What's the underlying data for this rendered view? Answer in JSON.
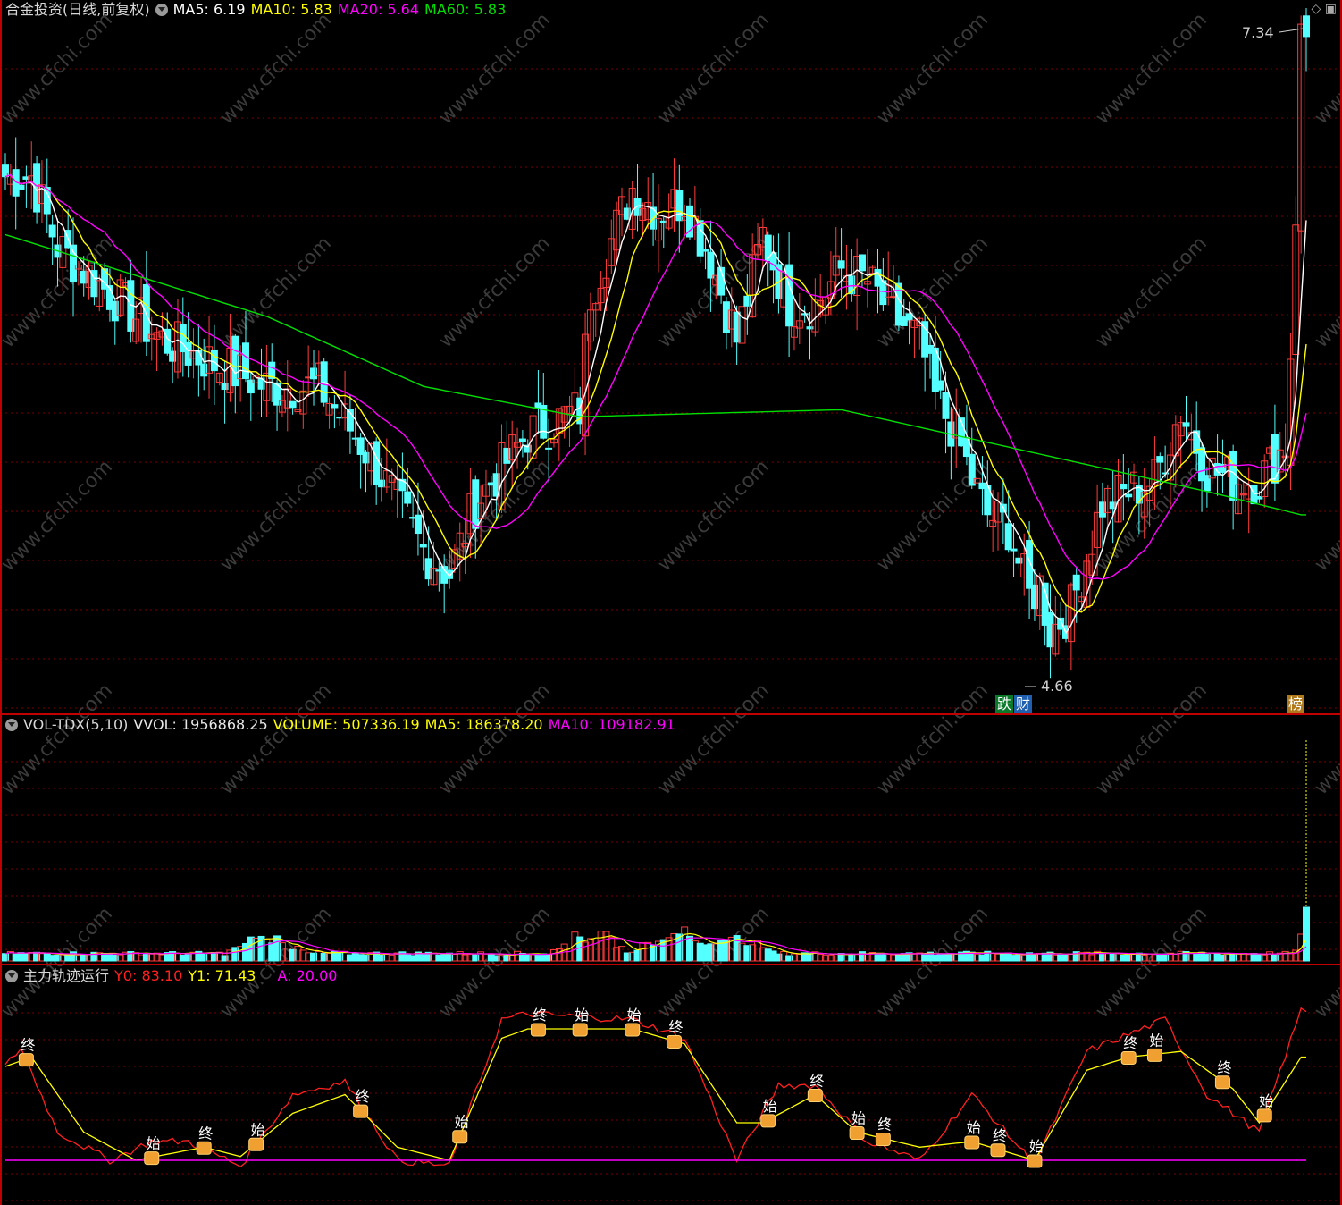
{
  "price_panel": {
    "title": "合金投资(日线,前复权)",
    "ma5": "MA5: 6.19",
    "ma10": "MA10: 5.83",
    "ma20": "MA20: 5.64",
    "ma60": "MA60: 5.83",
    "high_label": "7.34",
    "low_label": "4.66",
    "tags": [
      "跌",
      "财",
      "榜"
    ]
  },
  "volume_panel": {
    "title": "VOL-TDX(5,10)",
    "vvol": "VVOL: 1956868.25",
    "volume": "VOLUME: 507336.19",
    "ma5": "MA5: 186378.20",
    "ma10": "MA10: 109182.91"
  },
  "indicator_panel": {
    "title": "主力轨迹运行",
    "y0": "Y0: 83.10",
    "y1": "Y1: 71.43",
    "a": "A: 20.00",
    "start_label": "始",
    "end_label": "终"
  },
  "colors": {
    "up": "#ff3c3c",
    "down": "#54ffff",
    "ma5": "#ffffff",
    "ma10": "#ffff00",
    "ma20": "#ff00ff",
    "ma60": "#00e000",
    "grid": "#7a0000",
    "frame": "#c00000",
    "watermark": "#3a3a3a"
  },
  "watermark": "www.cfchi.com",
  "chart_data": [
    {
      "type": "candlestick",
      "title": "合金投资(日线,前复权)",
      "series_names": [
        "MA5",
        "MA10",
        "MA20",
        "MA60"
      ],
      "highest": 7.34,
      "lowest": 4.66,
      "close_anchors": [
        [
          0,
          6.7
        ],
        [
          5,
          6.7
        ],
        [
          10,
          6.4
        ],
        [
          20,
          6.2
        ],
        [
          30,
          6.0
        ],
        [
          40,
          5.9
        ],
        [
          50,
          5.8
        ],
        [
          60,
          5.8
        ],
        [
          70,
          5.5
        ],
        [
          80,
          5.1
        ],
        [
          85,
          5.0
        ],
        [
          90,
          5.3
        ],
        [
          100,
          5.6
        ],
        [
          110,
          5.7
        ],
        [
          112,
          6.2
        ],
        [
          120,
          6.65
        ],
        [
          125,
          6.55
        ],
        [
          130,
          6.6
        ],
        [
          135,
          6.35
        ],
        [
          140,
          6.0
        ],
        [
          145,
          6.45
        ],
        [
          150,
          6.15
        ],
        [
          155,
          6.15
        ],
        [
          160,
          6.3
        ],
        [
          165,
          6.25
        ],
        [
          170,
          6.1
        ],
        [
          175,
          6.0
        ],
        [
          178,
          5.75
        ],
        [
          182,
          5.6
        ],
        [
          185,
          5.4
        ],
        [
          188,
          5.25
        ],
        [
          192,
          5.2
        ],
        [
          196,
          4.9
        ],
        [
          198,
          4.95
        ],
        [
          200,
          4.75
        ],
        [
          204,
          4.85
        ],
        [
          210,
          5.3
        ],
        [
          215,
          5.35
        ],
        [
          220,
          5.4
        ],
        [
          225,
          5.7
        ],
        [
          230,
          5.45
        ],
        [
          235,
          5.4
        ],
        [
          240,
          5.4
        ],
        [
          245,
          5.55
        ],
        [
          246,
          5.95
        ],
        [
          247,
          6.55
        ],
        [
          248,
          7.3
        ]
      ],
      "ma60_anchors": [
        [
          0,
          6.45
        ],
        [
          50,
          6.1
        ],
        [
          80,
          5.8
        ],
        [
          110,
          5.67
        ],
        [
          160,
          5.7
        ],
        [
          200,
          5.5
        ],
        [
          230,
          5.35
        ],
        [
          248,
          5.25
        ]
      ]
    },
    {
      "type": "bar",
      "title": "VOL-TDX(5,10)",
      "volume_last": 507336.19,
      "ma5": 186378.2,
      "ma10": 109182.91,
      "vvol": 1956868.25,
      "bursts": [
        [
          50,
          4
        ],
        [
          112,
          5
        ],
        [
          128,
          6
        ],
        [
          140,
          4
        ]
      ],
      "last_bar_relative": 10
    },
    {
      "type": "line",
      "title": "主力轨迹运行",
      "series": [
        "Y0",
        "Y1",
        "A"
      ],
      "y0_last": 83.1,
      "y1_last": 71.43,
      "a_level": 20.0,
      "y1_anchors": [
        [
          0,
          70
        ],
        [
          5,
          75
        ],
        [
          15,
          35
        ],
        [
          25,
          20
        ],
        [
          38,
          27
        ],
        [
          45,
          22
        ],
        [
          55,
          45
        ],
        [
          65,
          55
        ],
        [
          75,
          27
        ],
        [
          85,
          20
        ],
        [
          95,
          85
        ],
        [
          100,
          90
        ],
        [
          120,
          90
        ],
        [
          130,
          82
        ],
        [
          140,
          40
        ],
        [
          145,
          40
        ],
        [
          155,
          55
        ],
        [
          163,
          35
        ],
        [
          175,
          27
        ],
        [
          185,
          30
        ],
        [
          197,
          20
        ],
        [
          207,
          68
        ],
        [
          215,
          75
        ],
        [
          225,
          78
        ],
        [
          235,
          58
        ],
        [
          240,
          40
        ],
        [
          248,
          75
        ]
      ],
      "y0_anchors": [
        [
          0,
          70
        ],
        [
          3,
          80
        ],
        [
          10,
          35
        ],
        [
          20,
          20
        ],
        [
          28,
          30
        ],
        [
          35,
          30
        ],
        [
          45,
          17
        ],
        [
          55,
          55
        ],
        [
          65,
          62
        ],
        [
          75,
          20
        ],
        [
          85,
          17
        ],
        [
          95,
          95
        ],
        [
          100,
          98
        ],
        [
          120,
          95
        ],
        [
          130,
          85
        ],
        [
          140,
          20
        ],
        [
          148,
          60
        ],
        [
          155,
          60
        ],
        [
          165,
          30
        ],
        [
          175,
          20
        ],
        [
          185,
          55
        ],
        [
          197,
          18
        ],
        [
          207,
          78
        ],
        [
          222,
          95
        ],
        [
          230,
          55
        ],
        [
          240,
          35
        ],
        [
          248,
          100
        ]
      ]
    }
  ]
}
